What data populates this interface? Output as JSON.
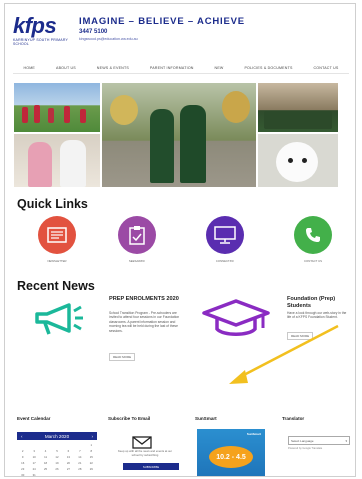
{
  "header": {
    "logo_word": "kfps",
    "logo_sub": "KARRINYUP SOUTH PRIMARY SCHOOL",
    "tagline": "IMAGINE – BELIEVE – ACHIEVE",
    "phone": "3447 5100",
    "email": "kingswood.ps@education.wa.edu.au"
  },
  "nav": {
    "items": [
      "HOME",
      "ABOUT US",
      "NEWS & EVENTS",
      "PARENT INFORMATION",
      "NEW",
      "POLICIES & DOCUMENTS",
      "CONTACT US"
    ]
  },
  "quick_links": {
    "title": "Quick Links",
    "items": [
      {
        "label": "NEWSLETTER",
        "color": "#e2523f",
        "icon": "newsletter-icon"
      },
      {
        "label": "SEESAW/KF",
        "color": "#9b4aa5",
        "icon": "clipboard-icon"
      },
      {
        "label": "CONNECT/KF",
        "color": "#5a2db0",
        "icon": "monitor-icon"
      },
      {
        "label": "CONTACT US",
        "color": "#43b04a",
        "icon": "phone-icon"
      }
    ]
  },
  "recent_news": {
    "title": "Recent News",
    "items": [
      {
        "title": "PREP ENROLMENTS 2020",
        "text": "School Transition Program - Pre-schoolers are invited to attend four sessions in our Foundation classrooms. A parent information session and morning tea will be held during the last of these sessions.",
        "button": "READ MORE",
        "icon": "megaphone-icon",
        "icon_color": "#1bb89a"
      },
      {
        "title": "",
        "text": "",
        "button": "",
        "icon": "graduation-cap-icon",
        "icon_color": "#8a2bc2"
      },
      {
        "title": "Foundation (Prep) Students",
        "text": "Have a look through our web-story in the life of a KFPS Foundation Student.",
        "button": "READ MORE",
        "icon": "",
        "icon_color": ""
      }
    ]
  },
  "footer": {
    "event_calendar": {
      "title": "Event Calendar",
      "month": "March 2020",
      "days": [
        "",
        "",
        "",
        "",
        "",
        "",
        "1",
        "2",
        "3",
        "4",
        "5",
        "6",
        "7",
        "8",
        "9",
        "10",
        "11",
        "12",
        "13",
        "14",
        "15",
        "16",
        "17",
        "18",
        "19",
        "20",
        "21",
        "22",
        "23",
        "24",
        "25",
        "26",
        "27",
        "28",
        "29",
        "30",
        "31"
      ]
    },
    "subscribe": {
      "title": "Subscribe To Email",
      "text": "Keep up with all the news and events at our school by subscribing",
      "button": "SUBSCRIBE"
    },
    "sunsmart": {
      "title": "SunSmart",
      "label": "SunSmart",
      "uv": "10.2 - 4.5"
    },
    "translator": {
      "title": "Translator",
      "select": "Select Language",
      "powered": "Powered by Google Translate"
    }
  },
  "annotation": {
    "arrow_color": "#f2c01f"
  }
}
